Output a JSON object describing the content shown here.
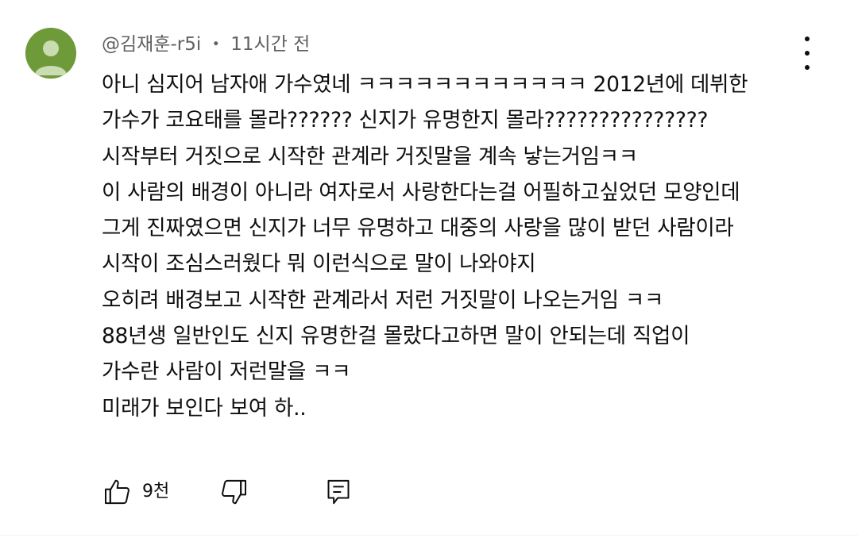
{
  "comment": {
    "author": "@김재훈-r5i",
    "separator": "・",
    "time": "11시간 전",
    "avatar_color": "#6f9a3a",
    "lines": [
      "아니 심지어 남자애 가수였네 ㅋㅋㅋㅋㅋㅋㅋㅋㅋㅋㅋㅋ 2012년에 데뷔한",
      "가수가 코요태를 몰라?????? 신지가 유명한지 몰라???????????????",
      "시작부터 거짓으로 시작한 관계라 거짓말을 계속 낳는거임ㅋㅋ",
      "이 사람의 배경이 아니라 여자로서 사랑한다는걸 어필하고싶었던 모양인데",
      "그게 진짜였으면 신지가 너무 유명하고 대중의 사랑을 많이 받던 사람이라",
      "시작이 조심스러웠다 뭐 이런식으로 말이 나와야지",
      "오히려 배경보고 시작한 관계라서 저런 거짓말이 나오는거임 ㅋㅋ",
      "88년생 일반인도 신지 유명한걸 몰랐다고하면 말이 안되는데 직업이",
      "가수란 사람이 저런말을 ㅋㅋ",
      "미래가 보인다 보여 하.."
    ],
    "like_count": "9천"
  },
  "icons": {
    "menu": "more-vertical-icon",
    "like": "thumbs-up-icon",
    "dislike": "thumbs-down-icon",
    "reply": "reply-comment-icon"
  }
}
